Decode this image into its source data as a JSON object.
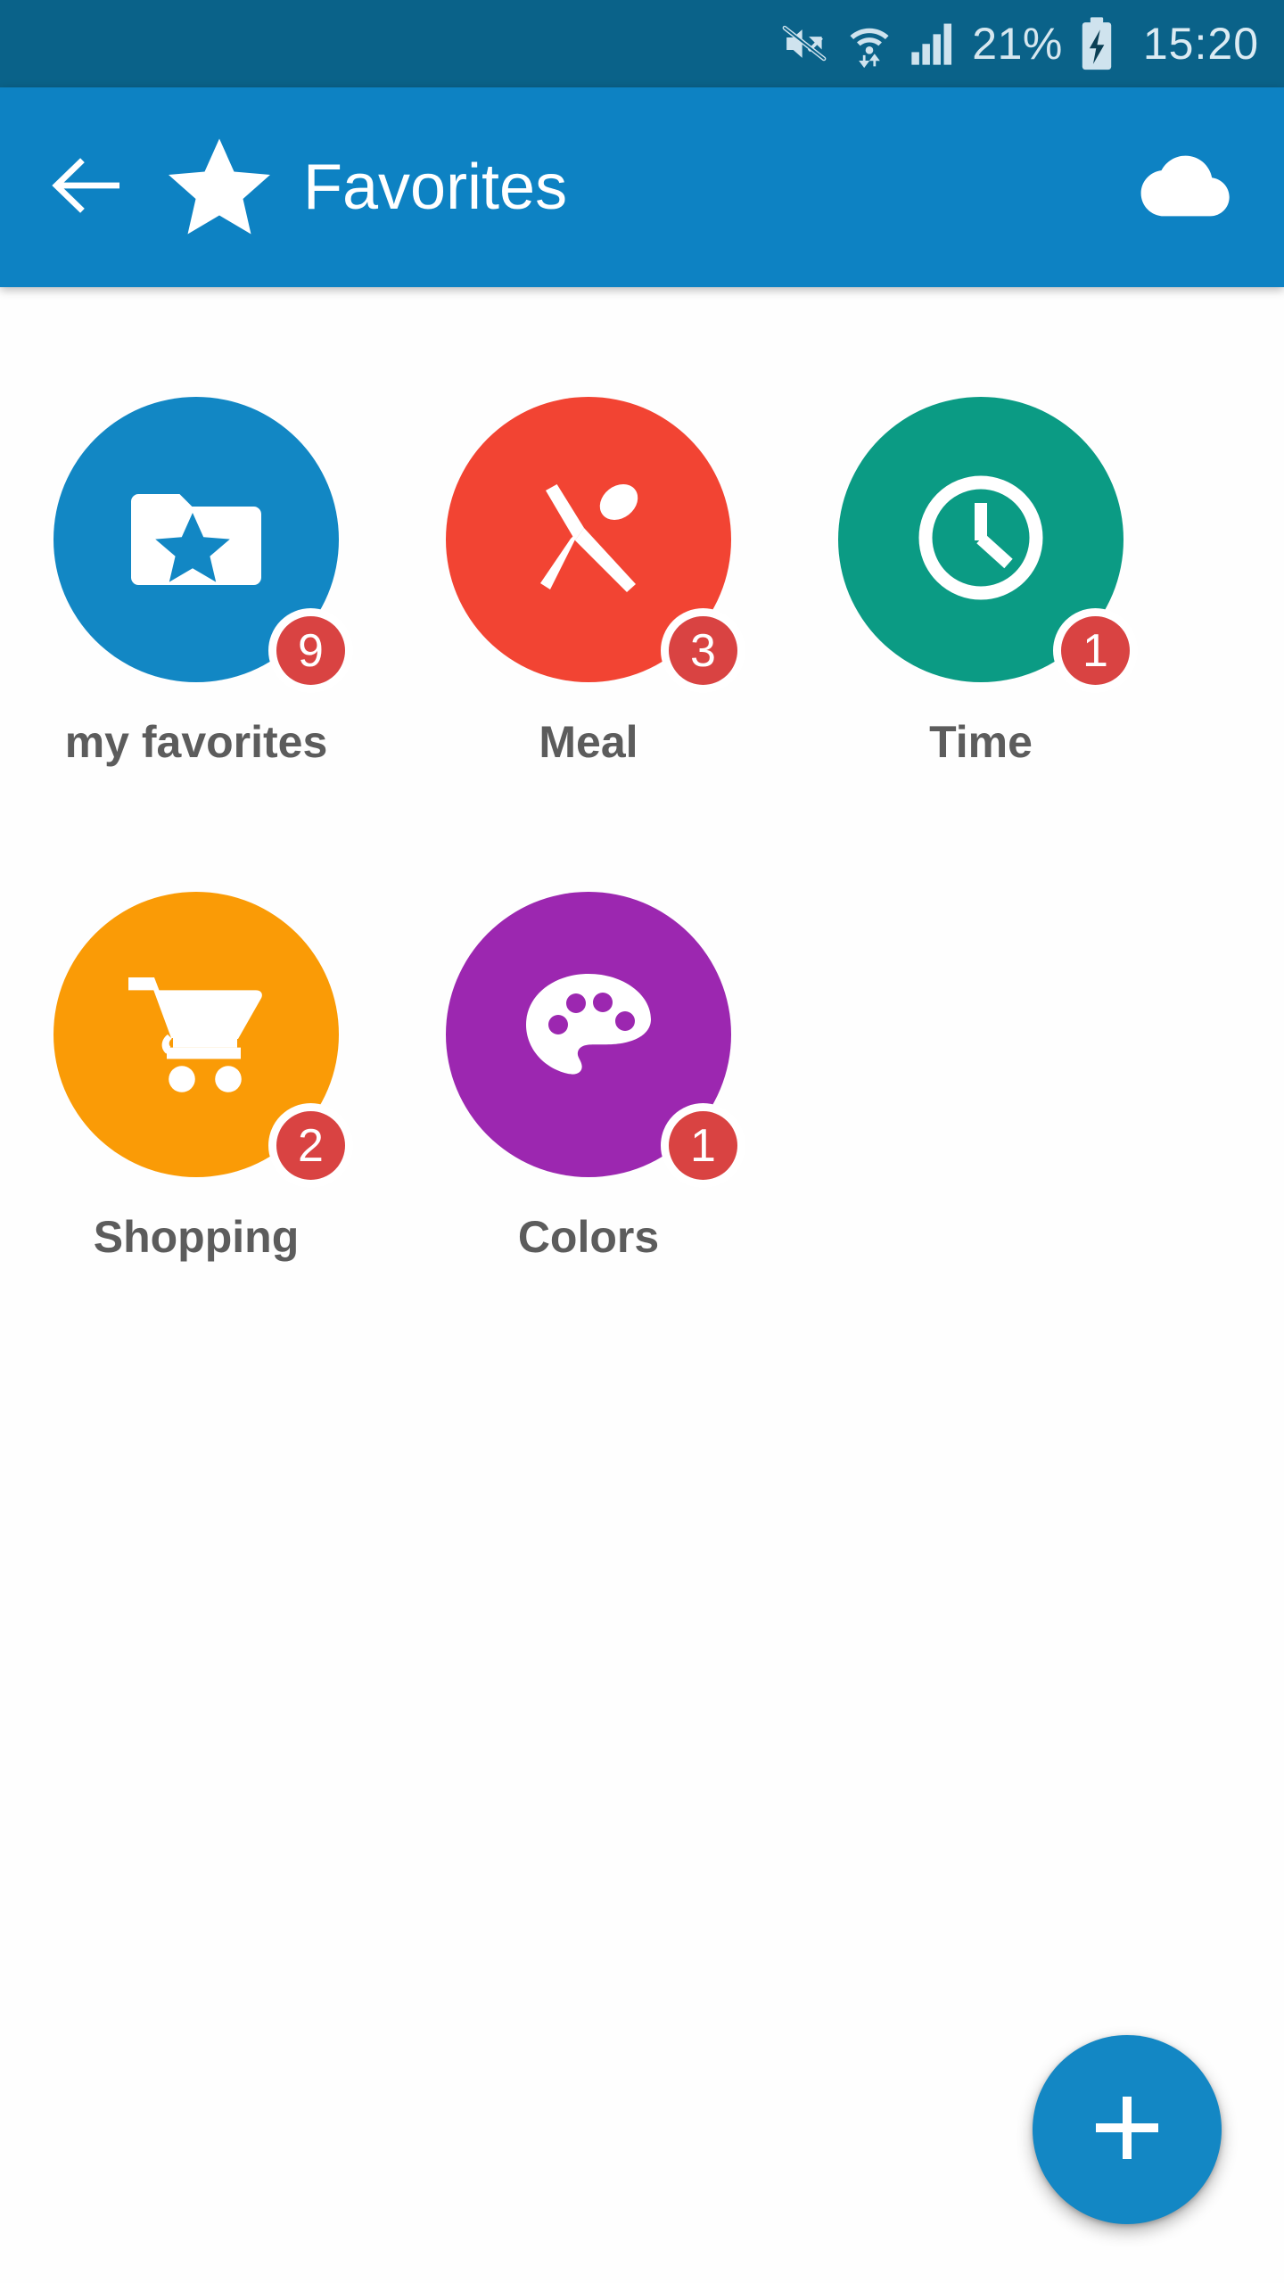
{
  "status_bar": {
    "battery_percent": "21%",
    "clock": "15:20",
    "icons": [
      "volume-mute-icon",
      "wifi-icon",
      "cellular-signal-icon",
      "battery-charging-icon"
    ],
    "background_color": "#0a6289",
    "text_color": "#d6e7ef"
  },
  "app_bar": {
    "title": "Favorites",
    "back_icon": "arrow-left-icon",
    "brand_icon": "star-icon",
    "action_icon": "cloud-download-icon",
    "background_color": "#0d82c3",
    "text_color": "#ffffff"
  },
  "grid": {
    "items": [
      {
        "label": "my favorites",
        "badge": "9",
        "color": "#1287c4",
        "icon": "folder-star-icon"
      },
      {
        "label": "Meal",
        "badge": "3",
        "color": "#f24433",
        "icon": "knife-spoon-icon"
      },
      {
        "label": "Time",
        "badge": "1",
        "color": "#0b9b84",
        "icon": "clock-icon"
      },
      {
        "label": "Shopping",
        "badge": "2",
        "color": "#fa9b06",
        "icon": "shopping-cart-icon"
      },
      {
        "label": "Colors",
        "badge": "1",
        "color": "#9c27b0",
        "icon": "palette-icon"
      }
    ],
    "badge_color": "#d94342",
    "label_color": "#5c5c5c"
  },
  "fab": {
    "icon": "plus-icon",
    "color": "#1387c4"
  }
}
